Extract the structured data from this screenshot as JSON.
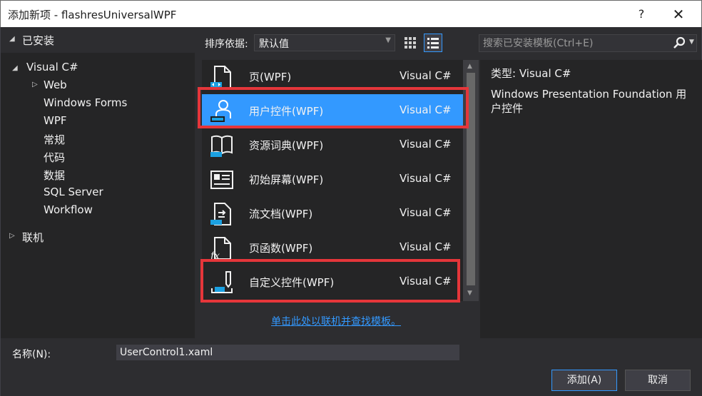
{
  "window": {
    "title": "添加新项 - flashresUniversalWPF",
    "help_label": "?",
    "close_label": "✕"
  },
  "tree": {
    "header": "已安装",
    "root": "Visual C#",
    "items": [
      "Web",
      "Windows Forms",
      "WPF",
      "常规",
      "代码",
      "数据",
      "SQL Server",
      "Workflow"
    ],
    "online": "联机"
  },
  "toolbar": {
    "sort_label": "排序依据:",
    "sort_value": "默认值",
    "search_placeholder": "搜索已安装模板(Ctrl+E)"
  },
  "templates": [
    {
      "name": "页(WPF)",
      "lang": "Visual C#",
      "icon": "page-icon"
    },
    {
      "name": "用户控件(WPF)",
      "lang": "Visual C#",
      "icon": "user-control-icon"
    },
    {
      "name": "资源词典(WPF)",
      "lang": "Visual C#",
      "icon": "resource-dictionary-icon"
    },
    {
      "name": "初始屏幕(WPF)",
      "lang": "Visual C#",
      "icon": "splash-screen-icon"
    },
    {
      "name": "流文档(WPF)",
      "lang": "Visual C#",
      "icon": "flow-document-icon"
    },
    {
      "name": "页函数(WPF)",
      "lang": "Visual C#",
      "icon": "page-function-icon"
    },
    {
      "name": "自定义控件(WPF)",
      "lang": "Visual C#",
      "icon": "custom-control-icon"
    }
  ],
  "online_link": "单击此处以联机并查找模板。",
  "details": {
    "type_label": "类型:",
    "type_value": "Visual C#",
    "description": "Windows Presentation Foundation 用户控件"
  },
  "form": {
    "name_label": "名称(N):",
    "name_value": "UserControl1.xaml",
    "add_button": "添加(A)",
    "cancel_button": "取消"
  },
  "colors": {
    "selection": "#3399ff",
    "highlight_box": "#e5363a",
    "link": "#3399ff"
  }
}
